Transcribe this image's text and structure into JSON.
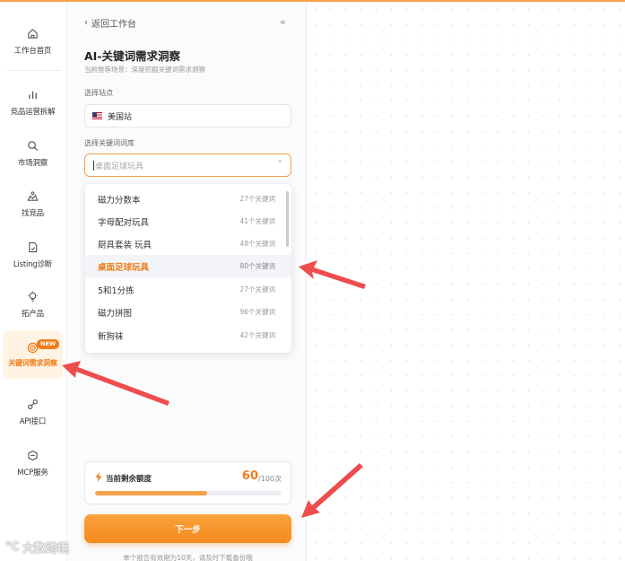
{
  "sidebar": {
    "items": [
      {
        "label": "工作台首页",
        "icon": "home-icon"
      },
      {
        "label": "竞品运营拆解",
        "icon": "bar-chart-icon"
      },
      {
        "label": "市场洞察",
        "icon": "search-icon"
      },
      {
        "label": "找竞品",
        "icon": "people-icon"
      },
      {
        "label": "Listing诊断",
        "icon": "document-icon"
      },
      {
        "label": "拓产品",
        "icon": "bulb-icon"
      },
      {
        "label": "关键词需求洞察",
        "icon": "target-icon"
      },
      {
        "label": "API接口",
        "icon": "link-icon"
      },
      {
        "label": "MCP服务",
        "icon": "mcp-icon"
      }
    ],
    "new_badge": "NEW"
  },
  "panel": {
    "back_label": "返回工作台",
    "title": "AI-关键词需求洞察",
    "subtitle": "当前推荐场景：深度挖掘关键词需求洞察",
    "site_label": "选择站点",
    "site_value": "美国站",
    "keyword_label": "选择关键词词库",
    "keyword_placeholder": "桌面足球玩具"
  },
  "dropdown": {
    "options": [
      {
        "name": "磁力分数本",
        "count": "27个关键词"
      },
      {
        "name": "字母配对玩具",
        "count": "41个关键词"
      },
      {
        "name": "厨具套装 玩具",
        "count": "48个关键词"
      },
      {
        "name": "桌面足球玩具",
        "count": "80个关键词",
        "selected": true
      },
      {
        "name": "5和1分拣",
        "count": "27个关键词"
      },
      {
        "name": "磁力拼图",
        "count": "96个关键词"
      },
      {
        "name": "新狗袜",
        "count": "42个关键词"
      }
    ]
  },
  "quota": {
    "label": "当前剩余额度",
    "used": "60",
    "total": "/100次",
    "progress_fraction": 0.6
  },
  "next_button": "下一步",
  "footnote": "单个报告有效期为10天，请及时下载备份哦",
  "watermark": "大数跨境",
  "colors": {
    "accent": "#f07c1c",
    "arrow": "#ee4d4d"
  }
}
